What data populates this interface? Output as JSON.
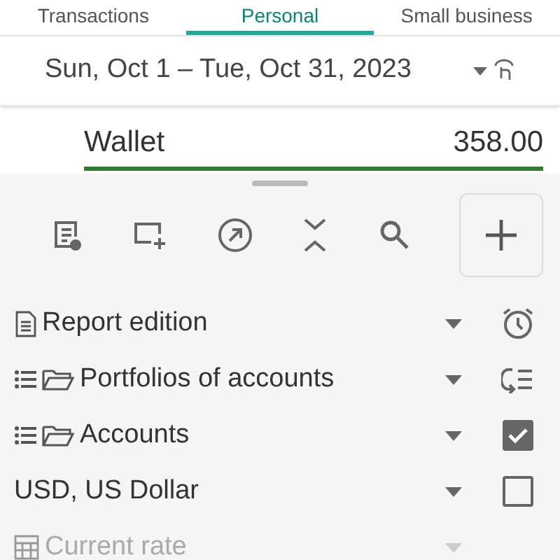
{
  "tabs": [
    {
      "label": "Transactions",
      "selected": false
    },
    {
      "label": "Personal",
      "selected": true
    },
    {
      "label": "Small business",
      "selected": false
    }
  ],
  "period": {
    "label": "Sun, Oct 1 – Tue, Oct 31, 2023"
  },
  "account": {
    "name": "Wallet",
    "amount": "358.00"
  },
  "options": [
    {
      "kind": "report",
      "label": "Report edition",
      "disabled": false
    },
    {
      "kind": "portfolios",
      "label": "Portfolios of accounts",
      "disabled": false
    },
    {
      "kind": "accounts",
      "label": "Accounts",
      "disabled": false,
      "checked": true
    },
    {
      "kind": "currency",
      "label": "USD, US Dollar",
      "disabled": false,
      "checked": false
    },
    {
      "kind": "rate",
      "label": "Current rate",
      "disabled": true
    }
  ]
}
